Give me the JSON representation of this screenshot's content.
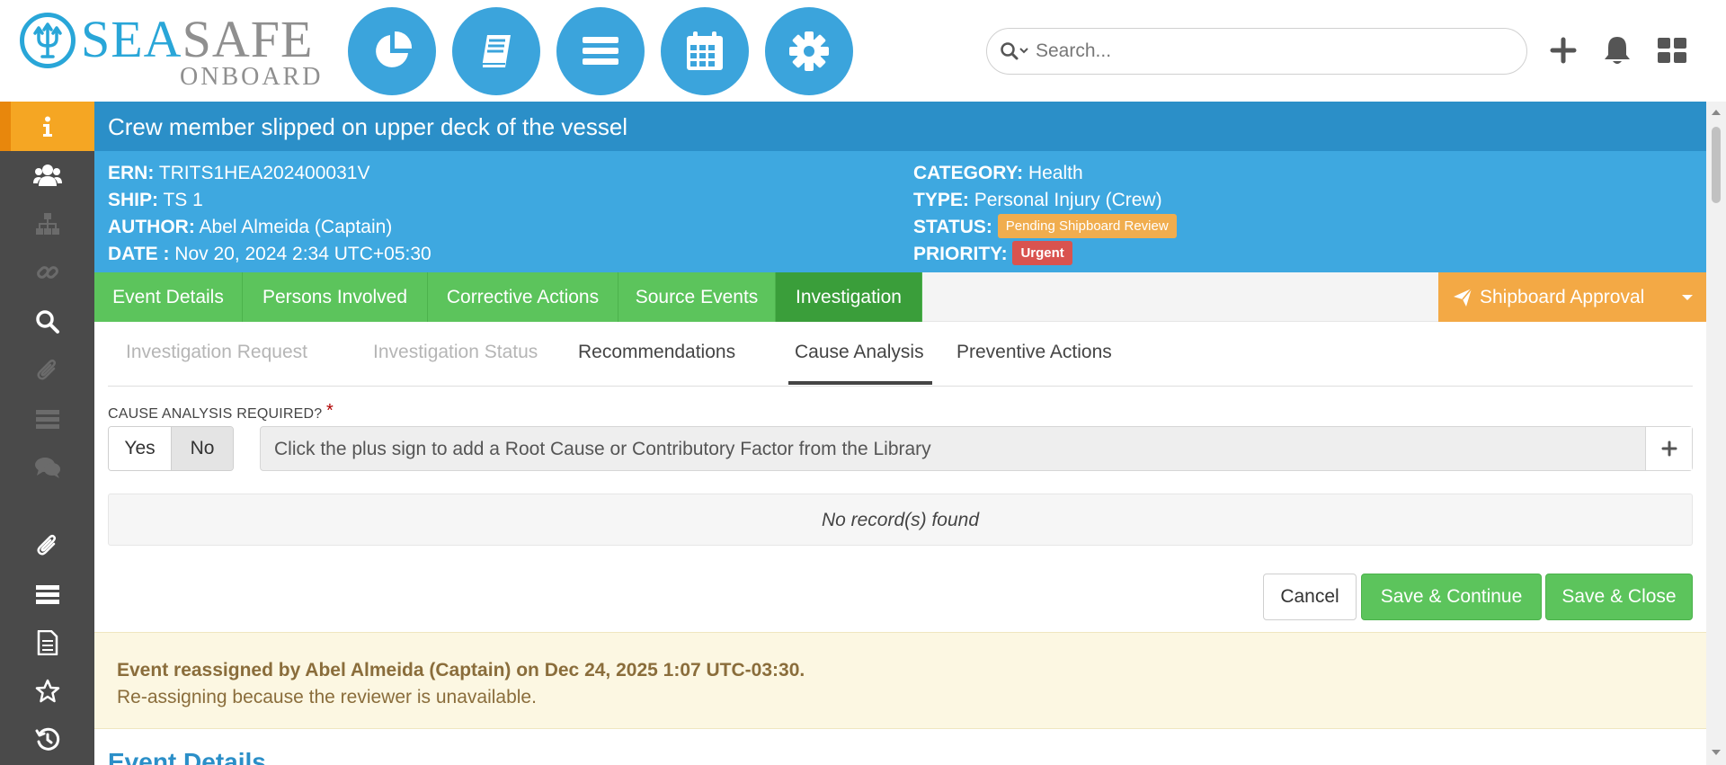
{
  "header": {
    "logo": {
      "primary": "SEA",
      "secondary": "SAFE",
      "sub": "ONBOARD"
    },
    "nav_icons": [
      "pie-chart-icon",
      "book-icon",
      "menu-icon",
      "calendar-icon",
      "gear-icon"
    ],
    "search": {
      "placeholder": "Search..."
    },
    "right_icons": [
      "plus-icon",
      "bell-icon",
      "grid-icon"
    ]
  },
  "sidebar": {
    "items": [
      {
        "icon": "info-icon",
        "active": true,
        "enabled": true
      },
      {
        "icon": "users-icon",
        "enabled": true
      },
      {
        "icon": "hierarchy-icon",
        "enabled": false
      },
      {
        "icon": "link-icon",
        "enabled": false
      },
      {
        "icon": "search-icon",
        "enabled": true
      },
      {
        "icon": "paperclip-icon",
        "enabled": false
      },
      {
        "icon": "list-icon",
        "enabled": false
      },
      {
        "icon": "comments-icon",
        "enabled": false
      },
      {
        "icon": "paperclip-icon",
        "enabled": true
      },
      {
        "icon": "list-icon",
        "enabled": true
      },
      {
        "icon": "document-icon",
        "enabled": true
      },
      {
        "icon": "star-icon",
        "enabled": true
      },
      {
        "icon": "history-icon",
        "enabled": true
      }
    ]
  },
  "event": {
    "title": "Crew member slipped on upper deck of the vessel",
    "left": [
      {
        "label": "ERN:",
        "value": "TRITS1HEA202400031V"
      },
      {
        "label": "SHIP:",
        "value": "TS 1"
      },
      {
        "label": "AUTHOR:",
        "value": "Abel Almeida (Captain)"
      },
      {
        "label": "DATE :",
        "value": "Nov 20, 2024 2:34 UTC+05:30"
      }
    ],
    "category": {
      "label": "CATEGORY:",
      "value": "Health"
    },
    "type": {
      "label": "TYPE:",
      "value": "Personal Injury (Crew)"
    },
    "status": {
      "label": "STATUS:",
      "value": "Pending Shipboard Review"
    },
    "priority": {
      "label": "PRIORITY:",
      "value": "Urgent"
    }
  },
  "tabs": [
    {
      "label": "Event Details",
      "active": false
    },
    {
      "label": "Persons Involved",
      "active": false
    },
    {
      "label": "Corrective Actions",
      "active": false
    },
    {
      "label": "Source Events",
      "active": false
    },
    {
      "label": "Investigation",
      "active": true
    }
  ],
  "approval": {
    "label": "Shipboard Approval"
  },
  "subtabs": [
    {
      "label": "Investigation Request",
      "disabled": true
    },
    {
      "label": "Investigation Status",
      "disabled": true
    },
    {
      "label": "Recommendations",
      "disabled": false
    },
    {
      "label": "Cause Analysis",
      "disabled": false,
      "active": true
    },
    {
      "label": "Preventive Actions",
      "disabled": false
    }
  ],
  "cause_analysis": {
    "label": "CAUSE ANALYSIS REQUIRED?",
    "required_mark": "*",
    "options": [
      "Yes",
      "No"
    ],
    "selected": "No",
    "placeholder": "Click the plus sign to add a Root Cause or Contributory Factor from the Library",
    "empty_message": "No record(s) found"
  },
  "actions": {
    "cancel": "Cancel",
    "save_continue": "Save & Continue",
    "save_close": "Save & Close"
  },
  "notice": {
    "title": "Event reassigned by Abel Almeida (Captain) on Dec 24, 2025 1:07 UTC-03:30.",
    "body": "Re-assigning because the reviewer is unavailable."
  },
  "next_section": "Event Details",
  "colors": {
    "brand_blue": "#29a6d8",
    "header_blue": "#2b8fc8",
    "info_blue": "#3ea8e0",
    "tab_green": "#5cc45c",
    "approval_orange": "#f3a945",
    "status_badge": "#f0ad4e",
    "priority_badge": "#d9534f"
  }
}
